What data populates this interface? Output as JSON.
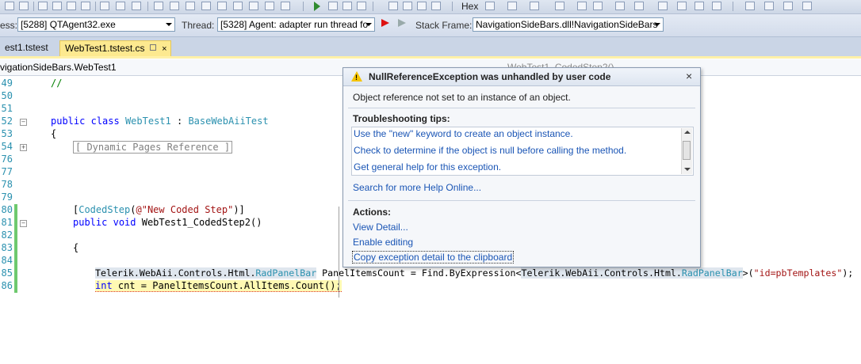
{
  "toolbar": {
    "hex_label": "Hex"
  },
  "debug_location": {
    "process_label": "ess:",
    "process_value": "[5288] QTAgent32.exe",
    "thread_label": "Thread:",
    "thread_value": "[5328] Agent: adapter run thread fo",
    "stack_label": "Stack Frame:",
    "stack_value": "NavigationSideBars.dll!NavigationSideBars"
  },
  "tabs": [
    {
      "label": "est1.tstest"
    },
    {
      "label": "WebTest1.tstest.cs"
    }
  ],
  "nav": {
    "left": "vigationSideBars.WebTest1",
    "right": "WebTest1_CodedStep2()"
  },
  "code": {
    "lines": [
      {
        "num": "49"
      },
      {
        "num": "50"
      },
      {
        "num": "51"
      },
      {
        "num": "52"
      },
      {
        "num": "53"
      },
      {
        "num": "54"
      },
      {
        "num": "76"
      },
      {
        "num": "77"
      },
      {
        "num": "78"
      },
      {
        "num": "79"
      },
      {
        "num": "80"
      },
      {
        "num": "81"
      },
      {
        "num": "82"
      },
      {
        "num": "83"
      },
      {
        "num": "84"
      },
      {
        "num": "85"
      },
      {
        "num": "86"
      }
    ],
    "comment": "//",
    "kw_public": "public",
    "kw_class": "class",
    "class_name": "WebTest1",
    "colon": " : ",
    "base_class": "BaseWebAiiTest",
    "brace_open": "{",
    "collapsed_region": "[ Dynamic Pages Reference ]",
    "attr_open": "[",
    "attr_name": "CodedStep",
    "attr_args_open": "(",
    "attr_string": "@\"New Coded Step\"",
    "attr_close": ")]",
    "kw_void": "void",
    "method_sig": " WebTest1_CodedStep2()",
    "line85_prefix": "Telerik.WebAii.Controls.Html.",
    "line85_type": "RadPanelBar",
    "line85_mid": " PanelItemsCount = Find.ByExpression<",
    "line85_generic": "Telerik.WebAii.Controls.Html.",
    "line85_type2": "RadPanelBar",
    "line85_args": ">(",
    "line85_string": "\"id=pbTemplates\"",
    "line85_end": ");",
    "kw_int": "int",
    "line86_rest": " cnt = PanelItemsCount.AllItems.Count();"
  },
  "popup": {
    "title": "NullReferenceException was unhandled by user code",
    "close": "×",
    "message": "Object reference not set to an instance of an object.",
    "tips_header": "Troubleshooting tips:",
    "tips": [
      "Use the \"new\" keyword to create an object instance.",
      "Check to determine if the object is null before calling the method.",
      "Get general help for this exception."
    ],
    "search_link": "Search for more Help Online...",
    "actions_header": "Actions:",
    "actions": [
      "View Detail...",
      "Enable editing",
      "Copy exception detail to the clipboard"
    ]
  },
  "colors": {
    "keyword": "#0000ff",
    "type": "#2b91af",
    "string": "#a31515",
    "comment": "#008000",
    "link": "#1a55b5",
    "active_tab": "#fde98f"
  }
}
